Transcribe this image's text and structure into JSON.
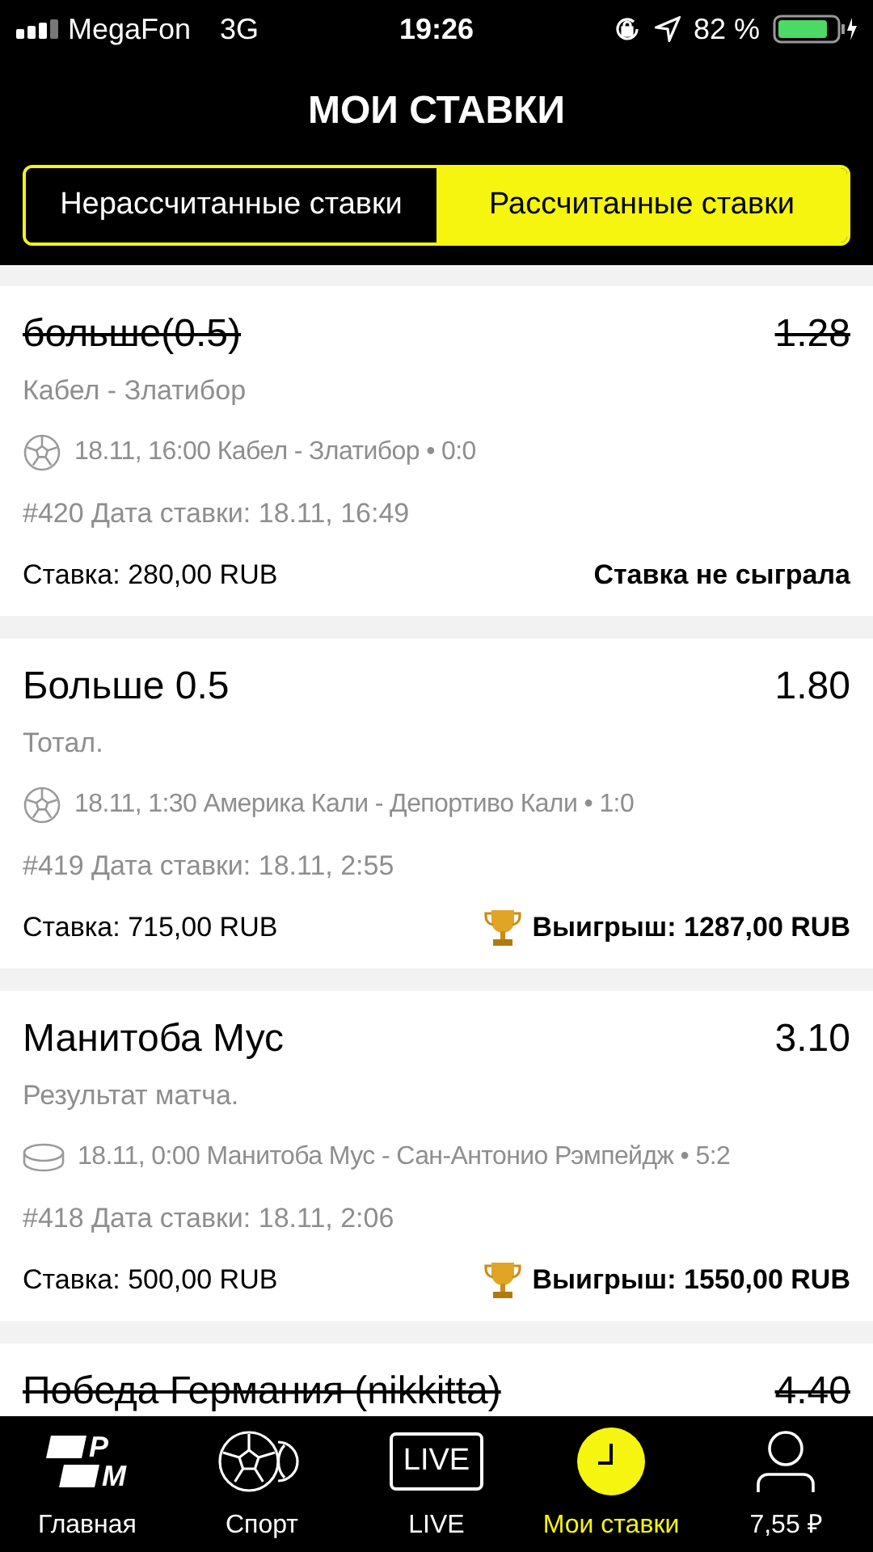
{
  "status_bar": {
    "carrier": "MegaFon",
    "network": "3G",
    "time": "19:26",
    "battery": "82 %"
  },
  "title": "МОИ СТАВКИ",
  "tabs": [
    {
      "label": "Нерассчитанные ставки",
      "selected": false
    },
    {
      "label": "Рассчитанные ставки",
      "selected": true
    }
  ],
  "bets": [
    {
      "title": "больше(0.5)",
      "odds": "1.28",
      "struck": true,
      "market": "Кабел - Златибор",
      "kind": "football",
      "event": "18.11, 16:00 Кабел - Златибор • 0:0",
      "info": "#420 Дата ставки: 18.11, 16:49",
      "stake": "Ставка: 280,00 RUB",
      "result": {
        "kind": "lost",
        "text": "Ставка не сыграла"
      }
    },
    {
      "title": "Больше 0.5",
      "odds": "1.80",
      "struck": false,
      "market": "Тотал.",
      "kind": "football",
      "event": "18.11, 1:30 Америка Кали - Депортиво Кали • 1:0",
      "info": "#419 Дата ставки: 18.11, 2:55",
      "stake": "Ставка: 715,00 RUB",
      "result": {
        "kind": "won",
        "text": "Выигрыш: 1287,00 RUB"
      }
    },
    {
      "title": "Манитоба Мус",
      "odds": "3.10",
      "struck": false,
      "market": "Результат матча.",
      "kind": "hockey",
      "event": "18.11, 0:00 Манитоба Мус - Сан-Антонио Рэмпейдж • 5:2",
      "info": "#418 Дата ставки: 18.11, 2:06",
      "stake": "Ставка: 500,00 RUB",
      "result": {
        "kind": "won",
        "text": "Выигрыш: 1550,00 RUB"
      }
    },
    {
      "title": "Победа Германия (nikkitta)",
      "odds": "4.40",
      "struck": true
    }
  ],
  "nav": [
    {
      "kind": "logo",
      "icon_text": [
        "P",
        "M"
      ],
      "label": "Главная",
      "selected": false
    },
    {
      "kind": "sport",
      "label": "Спорт",
      "selected": false
    },
    {
      "kind": "live",
      "icon_text": [
        "LIVE"
      ],
      "label": "LIVE",
      "selected": false
    },
    {
      "kind": "bets",
      "label": "Мои ставки",
      "selected": true
    },
    {
      "kind": "account",
      "label": "7,55 ₽",
      "selected": false
    }
  ]
}
